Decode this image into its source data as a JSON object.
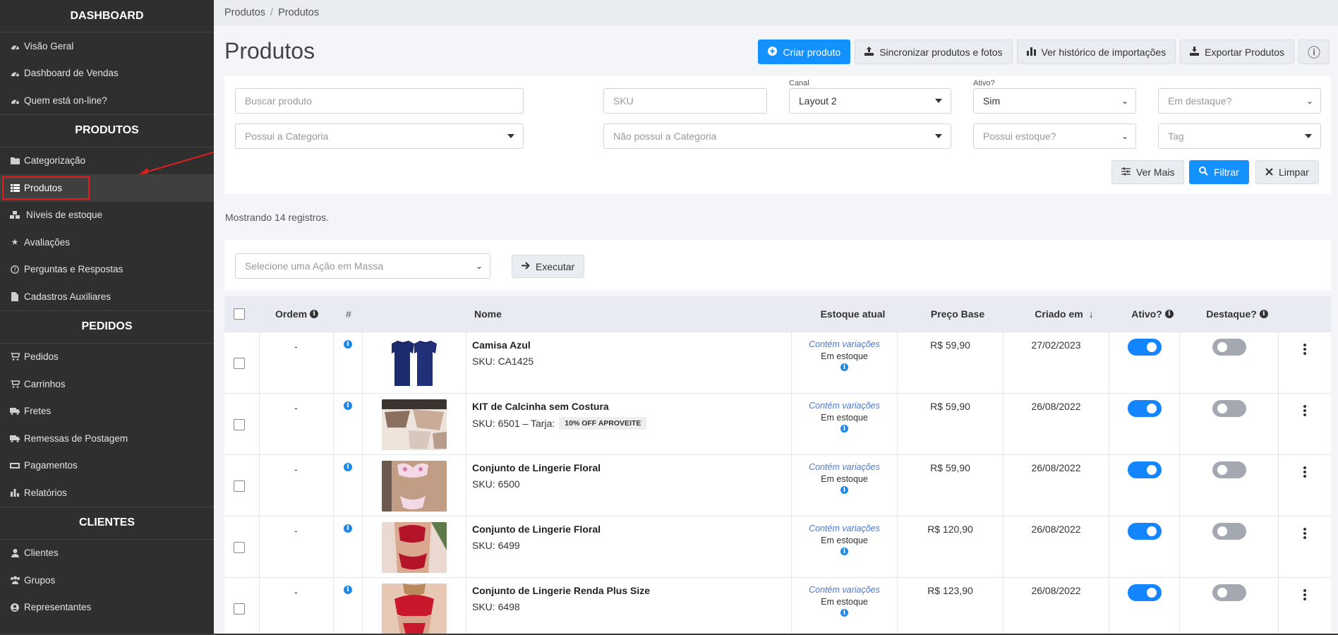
{
  "sidebar": {
    "sections": [
      {
        "title": "DASHBOARD",
        "items": [
          {
            "label": "Visão Geral",
            "icon": "dashboard-icon"
          },
          {
            "label": "Dashboard de Vendas",
            "icon": "dashboard-icon"
          },
          {
            "label": "Quem está on-line?",
            "icon": "dashboard-icon"
          }
        ]
      },
      {
        "title": "PRODUTOS",
        "items": [
          {
            "label": "Categorização",
            "icon": "folder-icon"
          },
          {
            "label": "Produtos",
            "icon": "list-icon"
          },
          {
            "label": "Níveis de estoque",
            "icon": "cubes-icon"
          },
          {
            "label": "Avaliações",
            "icon": "star-icon"
          },
          {
            "label": "Perguntas e Respostas",
            "icon": "question-icon"
          },
          {
            "label": "Cadastros Auxiliares",
            "icon": "file-icon"
          }
        ]
      },
      {
        "title": "PEDIDOS",
        "items": [
          {
            "label": "Pedidos",
            "icon": "cart-icon"
          },
          {
            "label": "Carrinhos",
            "icon": "cart-icon"
          },
          {
            "label": "Fretes",
            "icon": "truck-icon"
          },
          {
            "label": "Remessas de Postagem",
            "icon": "truck-icon"
          },
          {
            "label": "Pagamentos",
            "icon": "money-icon"
          },
          {
            "label": "Relatórios",
            "icon": "bar-chart-icon"
          }
        ]
      },
      {
        "title": "CLIENTES",
        "items": [
          {
            "label": "Clientes",
            "icon": "user-icon"
          },
          {
            "label": "Grupos",
            "icon": "users-icon"
          },
          {
            "label": "Representantes",
            "icon": "user-circle-icon"
          }
        ]
      }
    ],
    "active_item": "Produtos"
  },
  "breadcrumb": [
    "Produtos",
    "Produtos"
  ],
  "page_title": "Produtos",
  "toolbar": {
    "create": "Criar produto",
    "sync": "Sincronizar produtos e fotos",
    "history": "Ver histórico de importações",
    "export": "Exportar Produtos",
    "info": "ⓘ"
  },
  "filters": {
    "search_placeholder": "Buscar produto",
    "sku_placeholder": "SKU",
    "canal_label": "Canal",
    "canal_value": "Layout 2",
    "ativo_label": "Ativo?",
    "ativo_value": "Sim",
    "destaque_placeholder": "Em destaque?",
    "possui_categoria_placeholder": "Possui a Categoria",
    "nao_possui_categoria_placeholder": "Não possui a Categoria",
    "estoque_placeholder": "Possui estoque?",
    "tag_placeholder": "Tag",
    "ver_mais": "Ver Mais",
    "filtrar": "Filtrar",
    "limpar": "Limpar"
  },
  "count_text": "Mostrando 14 registros.",
  "bulk": {
    "placeholder": "Selecione uma Ação em Massa",
    "execute": "Executar"
  },
  "table": {
    "headers": {
      "ordem": "Ordem",
      "hash": "#",
      "nome": "Nome",
      "estoque": "Estoque atual",
      "preco": "Preço Base",
      "criado": "Criado em",
      "ativo": "Ativo?",
      "destaque": "Destaque?"
    },
    "rows": [
      {
        "ordem": "-",
        "name": "Camisa Azul",
        "sku": "SKU: CA1425",
        "tarja": "",
        "stock_var": "Contém variações",
        "stock_status": "Em estoque",
        "price": "R$ 59,90",
        "created": "27/02/2023",
        "ativo": true,
        "destaque": false
      },
      {
        "ordem": "-",
        "name": "KIT de Calcinha sem Costura",
        "sku": "SKU: 6501 – Tarja:",
        "tarja": "10% OFF APROVEITE",
        "stock_var": "Contém variações",
        "stock_status": "Em estoque",
        "price": "R$ 59,90",
        "created": "26/08/2022",
        "ativo": true,
        "destaque": false
      },
      {
        "ordem": "-",
        "name": "Conjunto de Lingerie Floral",
        "sku": "SKU: 6500",
        "tarja": "",
        "stock_var": "Contém variações",
        "stock_status": "Em estoque",
        "price": "R$ 59,90",
        "created": "26/08/2022",
        "ativo": true,
        "destaque": false
      },
      {
        "ordem": "-",
        "name": "Conjunto de Lingerie Floral",
        "sku": "SKU: 6499",
        "tarja": "",
        "stock_var": "Contém variações",
        "stock_status": "Em estoque",
        "price": "R$ 120,90",
        "created": "26/08/2022",
        "ativo": true,
        "destaque": false
      },
      {
        "ordem": "-",
        "name": "Conjunto de Lingerie Renda Plus Size",
        "sku": "SKU: 6498",
        "tarja": "",
        "stock_var": "Contém variações",
        "stock_status": "Em estoque",
        "price": "R$ 123,90",
        "created": "26/08/2022",
        "ativo": true,
        "destaque": false
      }
    ]
  },
  "colors": {
    "primary": "#1391ff",
    "sidebar": "#2f2f2f",
    "toggle_on": "#1285ff",
    "toggle_off": "#a3a8b1",
    "highlight": "#e01e1e"
  }
}
